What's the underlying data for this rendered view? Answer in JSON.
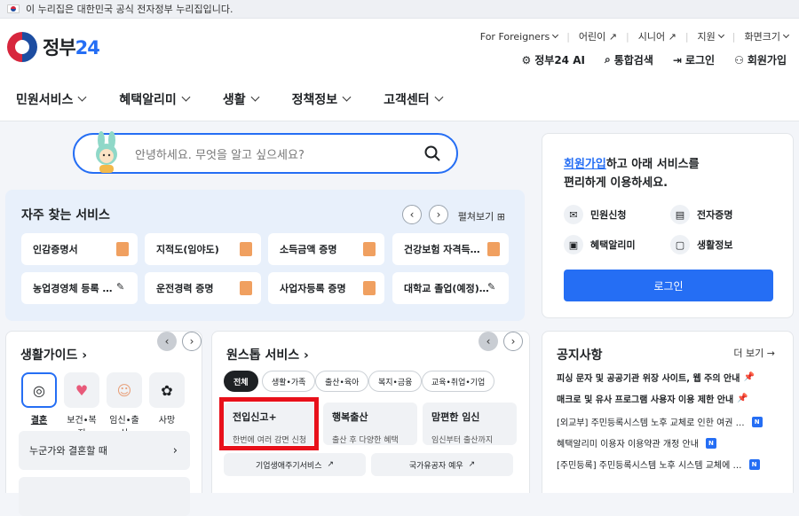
{
  "banner": {
    "text": "이 누리집은 대한민국 공식 전자정부 누리집입니다."
  },
  "logo": {
    "name": "정부",
    "num": "24"
  },
  "util": {
    "foreigners": "For Foreigners",
    "kids": "어린이",
    "senior": "시니어",
    "support": "지원",
    "fontsize": "화면크기"
  },
  "quick": {
    "ai": "정부24 AI",
    "search": "통합검색",
    "login": "로그인",
    "join": "회원가입"
  },
  "gnb": [
    "민원서비스",
    "혜택알리미",
    "생활",
    "정책정보",
    "고객센터"
  ],
  "search": {
    "placeholder": "안녕하세요. 무엇을 알고 싶으세요?"
  },
  "frequent": {
    "title": "자주 찾는 서비스",
    "expand": "펼쳐보기",
    "items": [
      "인감증명서",
      "지적도(임야도)",
      "소득금액 증명",
      "건강보험 자격득…",
      "농업경영체 등록 …",
      "운전경력 증명",
      "사업자등록 증명",
      "대학교 졸업(예정)…"
    ]
  },
  "login_box": {
    "link": "회원가입",
    "line1": "하고 아래 서비스를",
    "line2": "편리하게 이용하세요.",
    "services": [
      "민원신청",
      "전자증명",
      "혜택알리미",
      "생활정보"
    ],
    "button": "로그인"
  },
  "life_guide": {
    "title": "생활가이드",
    "cats": [
      "결혼",
      "보건•복지",
      "임신•출산",
      "사망"
    ],
    "rows": [
      "누군가와 결혼할 때"
    ]
  },
  "onestop": {
    "title": "원스톱 서비스",
    "chips": [
      "전체",
      "생활•가족",
      "출산•육아",
      "복지•금융",
      "교육•취업•기업"
    ],
    "cards": [
      {
        "title": "전입신고+",
        "desc": "한번에 여러 감면 신청"
      },
      {
        "title": "행복출산",
        "desc": "출산 후 다양한 혜택"
      },
      {
        "title": "맘편한 임신",
        "desc": "임신부터 출산까지"
      }
    ],
    "links": [
      "기업생애주기서비스",
      "국가유공자 예우"
    ]
  },
  "notice": {
    "title": "공지사항",
    "more": "더 보기",
    "items": [
      "피싱 문자 및 공공기관 위장 사이트, 웹 주의 안내",
      "매크로 및 유사 프로그램 사용자 이용 제한 안내",
      "[외교부] 주민등록시스템 노후 교체로 인한 여권 …",
      "혜택알리미 이용자 이용약관 개정 안내",
      "[주민등록] 주민등록시스템 노후 시스템 교체에 …"
    ],
    "badge": "N"
  }
}
